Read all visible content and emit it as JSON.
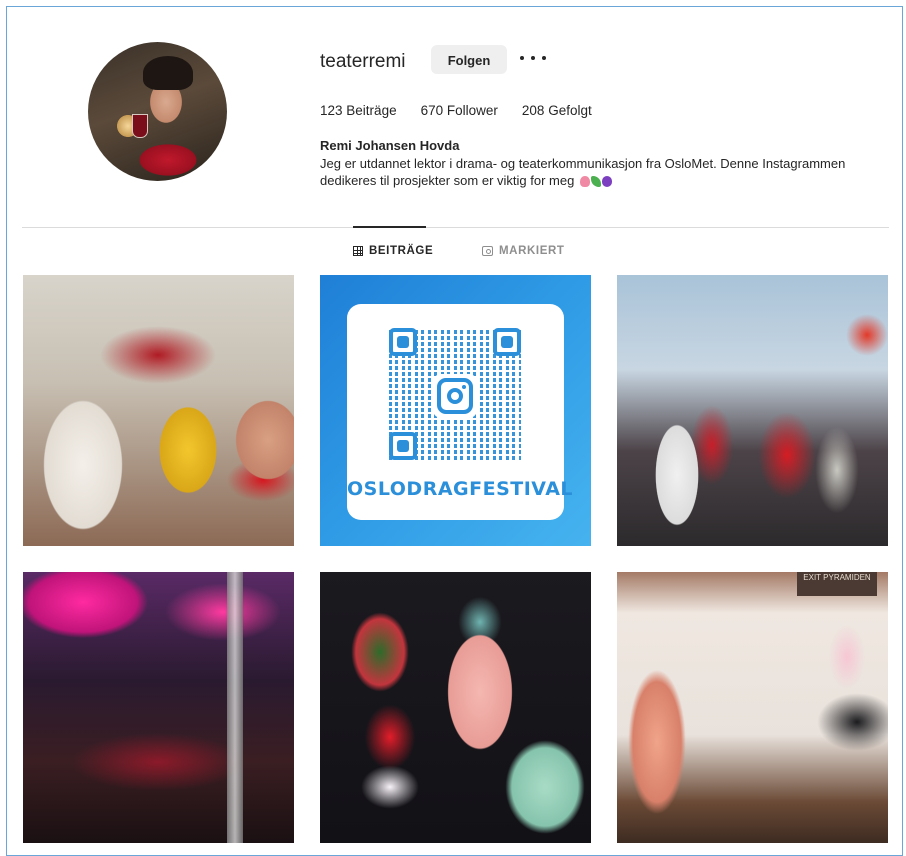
{
  "profile": {
    "username": "teaterremi",
    "follow_label": "Folgen",
    "more_label": "•••",
    "stats": [
      {
        "value": "123",
        "label": "Beiträge"
      },
      {
        "value": "670",
        "label": "Follower"
      },
      {
        "value": "208",
        "label": "Gefolgt"
      }
    ],
    "full_name": "Remi Johansen Hovda",
    "bio": "Jeg er utdannet lektor i drama- og teaterkommunikasjon fra OsloMet. Denne Instagrammen dedikeres til prosjekter som er viktig for meg"
  },
  "tabs": [
    {
      "label": "BEITRÄGE",
      "icon": "grid-icon",
      "active": true
    },
    {
      "label": "MARKIERT",
      "icon": "tag-icon",
      "active": false
    }
  ],
  "posts": [
    {
      "caption": ""
    },
    {
      "caption": "OSLODRAGFESTIVAL"
    },
    {
      "caption": ""
    },
    {
      "caption": ""
    },
    {
      "caption": ""
    },
    {
      "caption": "EXIT PYRAMIDEN"
    }
  ],
  "colors": {
    "accent": "#2b8fd9",
    "text": "#262626",
    "muted": "#8e8e8e",
    "button_bg": "#efefef"
  }
}
